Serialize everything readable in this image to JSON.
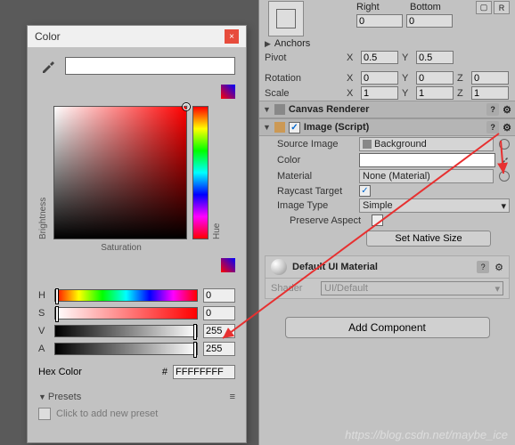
{
  "colorPicker": {
    "title": "Color",
    "brightness_label": "Brightness",
    "hue_label": "Hue",
    "saturation_label": "Saturation",
    "h": {
      "label": "H",
      "value": "0"
    },
    "s": {
      "label": "S",
      "value": "0"
    },
    "v": {
      "label": "V",
      "value": "255"
    },
    "a": {
      "label": "A",
      "value": "255"
    },
    "hex_label": "Hex Color",
    "hex_hash": "#",
    "hex_value": "FFFFFFFF",
    "presets_label": "Presets",
    "add_preset": "Click to add new preset"
  },
  "inspector": {
    "rect": {
      "right_label": "Right",
      "bottom_label": "Bottom",
      "right": "0",
      "bottom": "0",
      "anchors_label": "Anchors",
      "pivot_label": "Pivot",
      "pivot_x": "0.5",
      "pivot_y": "0.5",
      "rotation_label": "Rotation",
      "rot_x": "0",
      "rot_y": "0",
      "rot_z": "0",
      "scale_label": "Scale",
      "scale_x": "1",
      "scale_y": "1",
      "scale_z": "1",
      "rawedit": "R"
    },
    "canvas_renderer": "Canvas Renderer",
    "image": {
      "title": "Image (Script)",
      "source_label": "Source Image",
      "source_value": "Background",
      "color_label": "Color",
      "material_label": "Material",
      "material_value": "None (Material)",
      "raycast_label": "Raycast Target",
      "imagetype_label": "Image Type",
      "imagetype_value": "Simple",
      "preserve_label": "Preserve Aspect",
      "native_btn": "Set Native Size"
    },
    "material": {
      "name": "Default UI Material",
      "shader_label": "Shader",
      "shader_value": "UI/Default"
    },
    "add_component": "Add Component"
  },
  "watermark": "https://blog.csdn.net/maybe_ice"
}
